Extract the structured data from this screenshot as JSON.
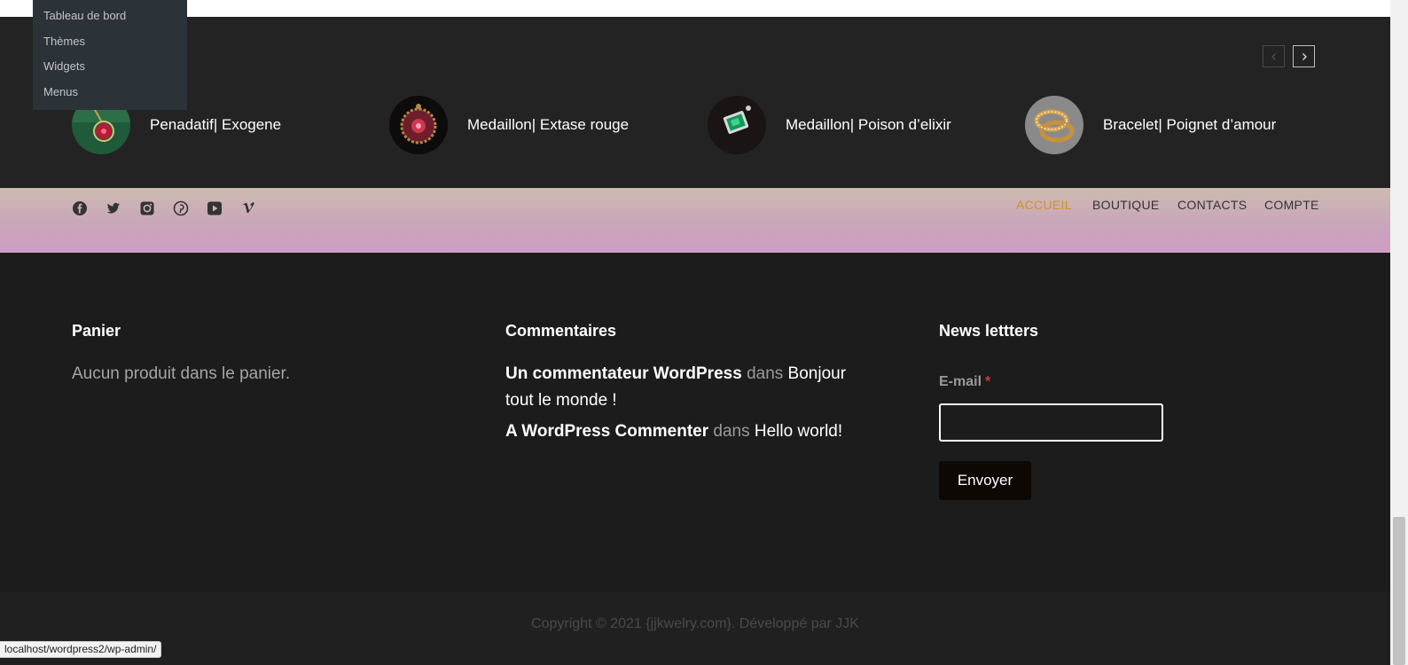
{
  "admin_menu": {
    "items": [
      {
        "label": "Tableau de bord"
      },
      {
        "label": "Thèmes"
      },
      {
        "label": "Widgets"
      },
      {
        "label": "Menus"
      }
    ]
  },
  "carousel": {
    "prev_icon": "chevron-left-icon",
    "next_icon": "chevron-right-icon",
    "products": [
      {
        "name": "Penadatif| Exogene"
      },
      {
        "name": "Medaillon| Extase rouge"
      },
      {
        "name": "Medaillon| Poison d’elixir"
      },
      {
        "name": "Bracelet| Poignet d’amour"
      }
    ]
  },
  "social": {
    "icons": [
      "facebook-icon",
      "twitter-icon",
      "instagram-icon",
      "pinterest-icon",
      "youtube-icon",
      "vimeo-icon"
    ]
  },
  "nav": {
    "items": [
      {
        "label": "ACCUEIL",
        "active": true
      },
      {
        "label": "BOUTIQUE",
        "active": false
      },
      {
        "label": "CONTACTS",
        "active": false
      },
      {
        "label": "COMPTE",
        "active": false
      }
    ]
  },
  "widgets": {
    "cart": {
      "title": "Panier",
      "empty_text": "Aucun produit dans le panier."
    },
    "comments": {
      "title": "Commentaires",
      "items": [
        {
          "author": "Un commentateur WordPress",
          "sep": "dans",
          "post": "Bonjour tout le monde !"
        },
        {
          "author": "A WordPress Commenter",
          "sep": "dans",
          "post": "Hello world!"
        }
      ]
    },
    "newsletter": {
      "title": "News lettters",
      "email_label": "E-mail",
      "required_mark": "*",
      "email_value": "",
      "submit_label": "Envoyer"
    }
  },
  "footer": {
    "copyright": "Copyright © 2021 {jjkwelry.com}. Développé par JJK"
  },
  "status_bar": {
    "url": "localhost/wordpress2/wp-admin/"
  },
  "colors": {
    "accent": "#d1912f",
    "footer_bg": "#1c1c1c",
    "band_bg": "#232323",
    "gradient_top": "#cdbbb0",
    "gradient_bottom": "#cf9cc4"
  }
}
